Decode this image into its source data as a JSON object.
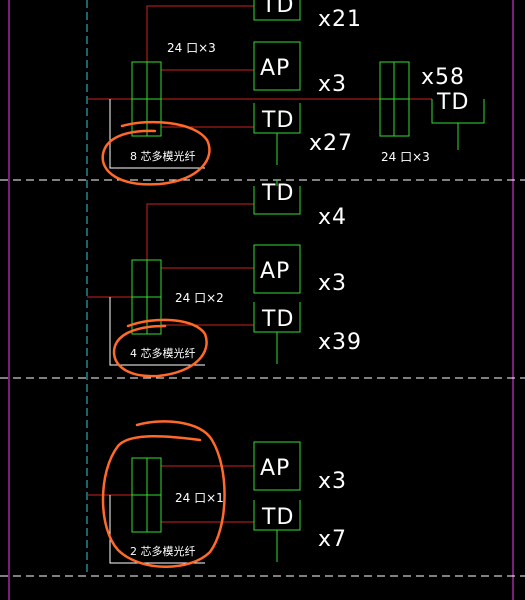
{
  "colors": {
    "background": "#000000",
    "frame": "#cc33cc",
    "riser": "#33cccc",
    "divider": "#ffffff",
    "cable": "#cc2222",
    "device": "#33dd33",
    "annotation": "#ff6a2a",
    "text": "#ffffff"
  },
  "sections": [
    {
      "id": "upper",
      "splitter_label": "24 口×3",
      "fiber_label": "8 芯多模光纤",
      "devices": [
        {
          "type": "TD",
          "label": "TD",
          "count": "x21"
        },
        {
          "type": "AP",
          "label": "AP",
          "count": "x3"
        },
        {
          "type": "TD",
          "label": "TD",
          "count": "x27"
        }
      ]
    },
    {
      "id": "middle",
      "splitter_label": "24 口×2",
      "fiber_label": "4 芯多模光纤",
      "devices": [
        {
          "type": "TD",
          "label": "TD",
          "count": "x4"
        },
        {
          "type": "AP",
          "label": "AP",
          "count": "x3"
        },
        {
          "type": "TD",
          "label": "TD",
          "count": "x39"
        }
      ]
    },
    {
      "id": "lower",
      "splitter_label": "24 口×1",
      "fiber_label": "2 芯多模光纤",
      "devices": [
        {
          "type": "AP",
          "label": "AP",
          "count": "x3"
        },
        {
          "type": "TD",
          "label": "TD",
          "count": "x7"
        }
      ]
    }
  ],
  "right_group": {
    "splitter_label": "24 口×3",
    "device_label": "TD",
    "count": "x58"
  }
}
